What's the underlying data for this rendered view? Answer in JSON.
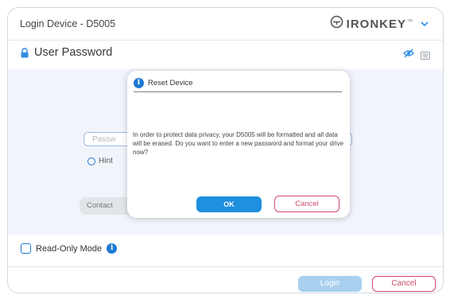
{
  "window": {
    "title": "Login Device - D5005",
    "brand": {
      "name": "IRONKEY",
      "tm": "™",
      "logo_icon": "ironkey-logo-icon",
      "menu_icon": "chevron-down-icon"
    }
  },
  "section": {
    "title": "User Password",
    "lock_icon": "lock-icon",
    "visibility_icon": "eye-off-icon",
    "keyboard_icon": "keyboard-icon"
  },
  "form": {
    "password_placeholder": "Password",
    "password_visible_text": "Passw",
    "hint_label": "Hint",
    "contact_label": "Contact"
  },
  "options": {
    "readonly_label": "Read-Only Mode",
    "readonly_checked": false,
    "info_icon": "info-icon"
  },
  "footer": {
    "login_label": "Login",
    "cancel_label": "Cancel"
  },
  "dialog": {
    "title": "Reset Device",
    "message": "In order to protect data privacy, your D5005 will be formatted and all data will be erased. Do you want to enter a new password and format your drive now?",
    "ok_label": "OK",
    "cancel_label": "Cancel"
  },
  "colors": {
    "accent": "#1f79d2",
    "danger": "#cf4a6c",
    "login_disabled": "#a9d0ef",
    "panel_bg": "#f1f5fb"
  }
}
